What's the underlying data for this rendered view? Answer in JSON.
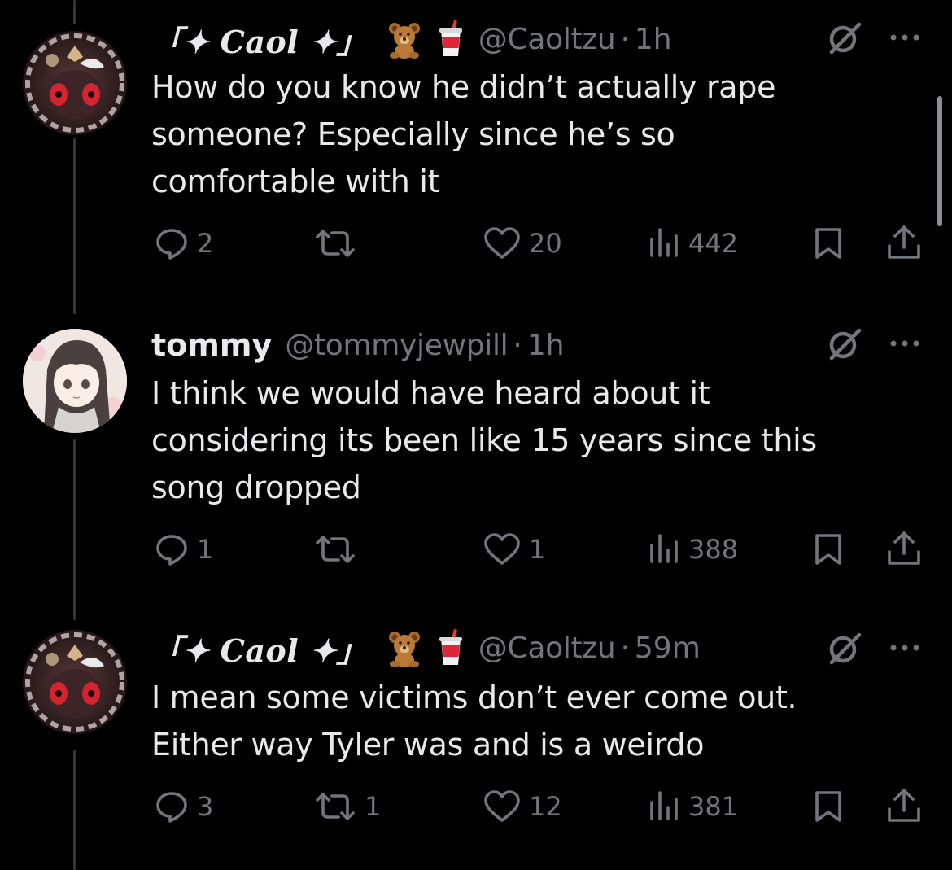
{
  "tweets": [
    {
      "display_name": "「✦ Caol ✦」",
      "emoji": [
        "teddy-bear",
        "cup-with-straw"
      ],
      "handle": "@Caoltzu",
      "separator": "·",
      "time": "1h",
      "text": "How do you know he didn’t actually rape someone? Especially since he’s so comfortable with it",
      "replies": "2",
      "reposts": "",
      "likes": "20",
      "views": "442"
    },
    {
      "display_name": "tommy",
      "emoji": [],
      "handle": "@tommyjewpill",
      "separator": "·",
      "time": "1h",
      "text": "I think we would have heard about it considering its been like 15 years since this song dropped",
      "replies": "1",
      "reposts": "",
      "likes": "1",
      "views": "388"
    },
    {
      "display_name": "「✦ Caol ✦」",
      "emoji": [
        "teddy-bear",
        "cup-with-straw"
      ],
      "handle": "@Caoltzu",
      "separator": "·",
      "time": "59m",
      "text": "I mean some victims don’t ever come out. Either way Tyler was and is a weirdo",
      "replies": "3",
      "reposts": "1",
      "likes": "12",
      "views": "381"
    }
  ],
  "icons": {
    "reply": "speech-bubble-icon",
    "repost": "repost-arrows-icon",
    "like": "heart-icon",
    "views": "bar-chart-icon",
    "bookmark": "bookmark-icon",
    "share": "share-icon",
    "grok": "grok-icon",
    "more": "more-dots-icon"
  },
  "colors": {
    "background": "#000000",
    "text": "#e7e9ea",
    "muted": "#71767b",
    "thread_line": "#333639"
  }
}
